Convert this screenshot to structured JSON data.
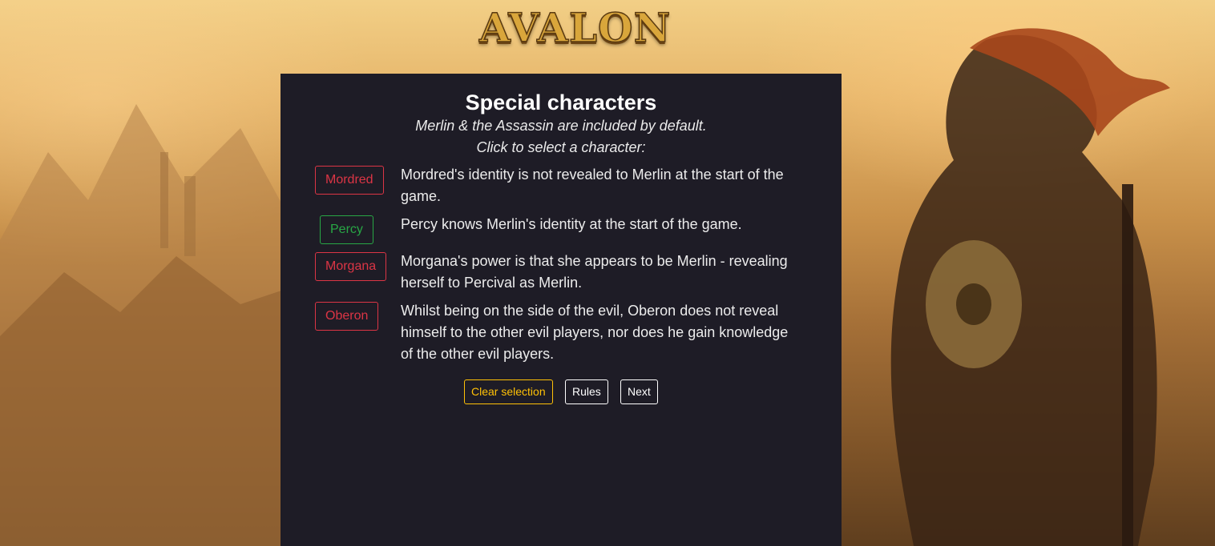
{
  "logo": {
    "text": "AVALON"
  },
  "panel": {
    "title": "Special characters",
    "subtitle_line1": "Merlin & the Assassin are included by default.",
    "subtitle_line2": "Click to select a character:"
  },
  "characters": [
    {
      "name": "Mordred",
      "side": "evil",
      "description": "Mordred's identity is not revealed to Merlin at the start of the game."
    },
    {
      "name": "Percy",
      "side": "good",
      "description": "Percy knows Merlin's identity at the start of the game."
    },
    {
      "name": "Morgana",
      "side": "evil",
      "description": "Morgana's power is that she appears to be Merlin - revealing herself to Percival as Merlin."
    },
    {
      "name": "Oberon",
      "side": "evil",
      "description": "Whilst being on the side of the evil, Oberon does not reveal himself to the other evil players, nor does he gain knowledge of the other evil players."
    }
  ],
  "actions": {
    "clear_label": "Clear selection",
    "rules_label": "Rules",
    "next_label": "Next"
  },
  "colors": {
    "evil": "#dc3545",
    "good": "#28a745",
    "warning": "#ffc107",
    "panel_bg": "#1e1c26"
  }
}
